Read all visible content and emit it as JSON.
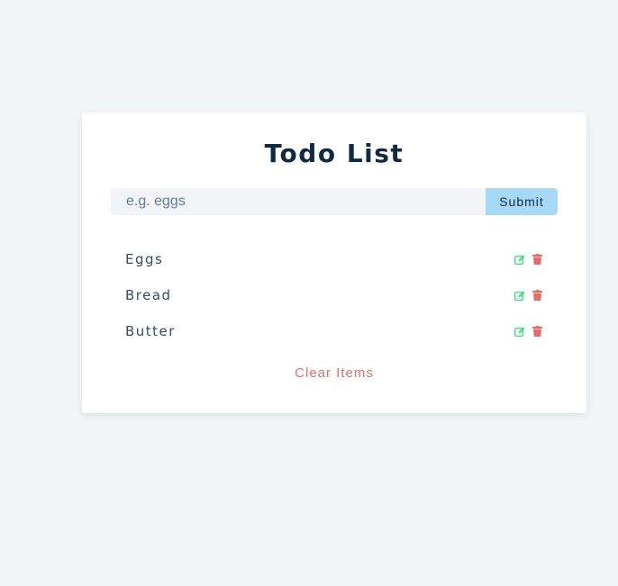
{
  "app": {
    "title": "Todo List"
  },
  "form": {
    "placeholder": "e.g. eggs",
    "value": "",
    "submit_label": "Submit"
  },
  "items": [
    {
      "label": "Eggs"
    },
    {
      "label": "Bread"
    },
    {
      "label": "Butter"
    }
  ],
  "actions": {
    "clear_label": "Clear Items"
  },
  "icons": {
    "edit": "edit-icon",
    "delete": "trash-icon"
  },
  "colors": {
    "background": "#f1f5f8",
    "card": "#ffffff",
    "title": "#102a43",
    "submit_bg": "#a6d8f8",
    "edit": "#4ade80",
    "delete": "#e66b6b",
    "clear": "#e66b6b"
  }
}
